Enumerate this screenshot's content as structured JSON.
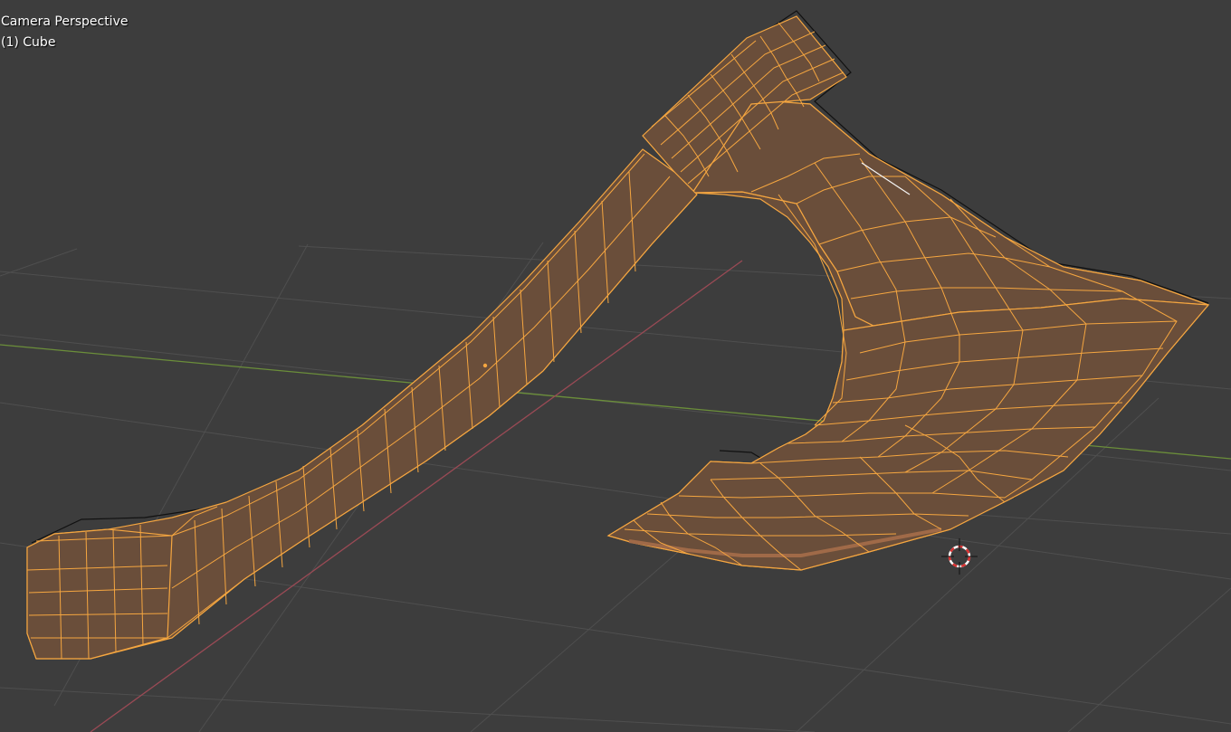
{
  "viewport": {
    "view_name": "Camera Perspective",
    "object_info": "(1) Cube"
  },
  "scene": {
    "background_color": "#3d3d3d",
    "grid_color": "#4f4f4f",
    "x_axis_color": "#9a4a55",
    "y_axis_color": "#6b8e3a",
    "mesh_fill_color": "#6a4e3a",
    "wire_color": "#f5a640",
    "edge_dark_color": "#111111",
    "cursor_colors": [
      "#d83030",
      "#ffffff"
    ]
  },
  "mesh": {
    "name": "Cube",
    "selected": true,
    "mode": "wireframe-overlay"
  },
  "cursor": {
    "name": "3d-cursor-icon"
  }
}
